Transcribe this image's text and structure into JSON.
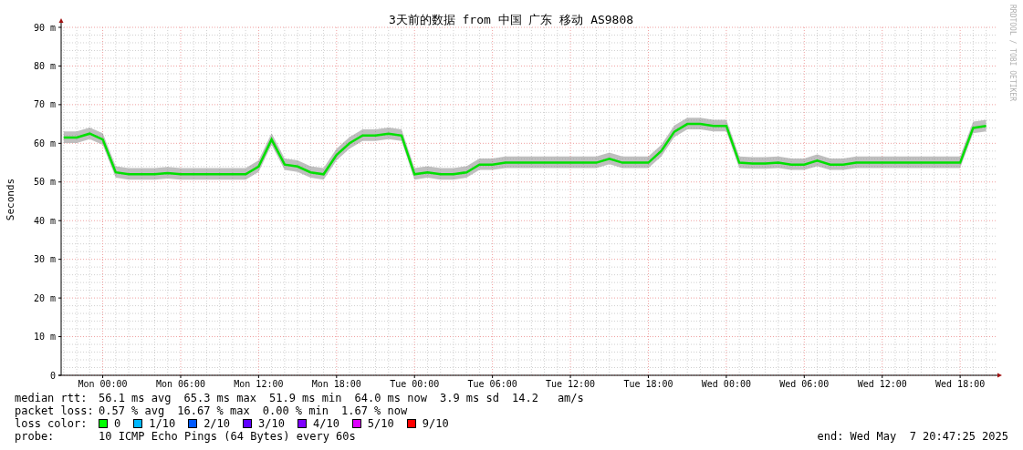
{
  "chart": {
    "chart_data": {
      "type": "line",
      "title": "3天前的数据 from 中国 广东 移动 AS9808",
      "ylabel": "Seconds",
      "categories": [
        null,
        null,
        null,
        "Mon 00:00",
        null,
        null,
        null,
        null,
        null,
        "Mon 06:00",
        null,
        null,
        null,
        null,
        null,
        "Mon 12:00",
        null,
        null,
        null,
        null,
        null,
        "Mon 18:00",
        null,
        null,
        null,
        null,
        null,
        "Tue 00:00",
        null,
        null,
        null,
        null,
        null,
        "Tue 06:00",
        null,
        null,
        null,
        null,
        null,
        "Tue 12:00",
        null,
        null,
        null,
        null,
        null,
        "Tue 18:00",
        null,
        null,
        null,
        null,
        null,
        "Wed 00:00",
        null,
        null,
        null,
        null,
        null,
        "Wed 06:00",
        null,
        null,
        null,
        null,
        null,
        "Wed 12:00",
        null,
        null,
        null,
        null,
        null,
        "Wed 18:00",
        null,
        null
      ],
      "series": [
        {
          "color": "#00e000",
          "values": [
            61.5,
            61.5,
            62.5,
            61,
            52.5,
            52,
            52,
            52,
            52.3,
            52,
            52,
            52,
            52,
            52,
            52,
            54,
            61,
            54.5,
            54,
            52.5,
            52,
            57,
            60,
            62,
            62,
            62.5,
            62,
            52,
            52.5,
            52,
            52,
            52.5,
            54.5,
            54.5,
            55,
            55,
            55,
            55,
            55,
            55,
            55,
            55,
            56,
            55,
            55,
            55,
            58,
            63,
            65,
            65,
            64.5,
            64.5,
            55,
            54.8,
            54.8,
            55,
            54.5,
            54.5,
            55.5,
            54.5,
            54.5,
            55,
            55,
            55,
            55,
            55,
            55,
            55,
            55,
            55,
            64,
            64.5
          ]
        }
      ],
      "ylim": [
        0,
        90
      ],
      "grid": true,
      "yticks": [
        {
          "value": 0,
          "label": "0"
        },
        {
          "value": 10,
          "label": "10 m"
        },
        {
          "value": 20,
          "label": "20 m"
        },
        {
          "value": 30,
          "label": "30 m"
        },
        {
          "value": 40,
          "label": "40 m"
        },
        {
          "value": 50,
          "label": "50 m"
        },
        {
          "value": 60,
          "label": "60 m"
        },
        {
          "value": 70,
          "label": "70 m"
        },
        {
          "value": 80,
          "label": "80 m"
        },
        {
          "value": 90,
          "label": "90 m"
        }
      ]
    },
    "watermark_credit": "RRDTOOL / TOBI OETIKER"
  },
  "legend": {
    "median_rtt": {
      "label": "median rtt:",
      "items": [
        "56.1 ms avg",
        "65.3 ms max",
        "51.9 ms min",
        "64.0 ms now",
        "3.9 ms sd",
        "14.2",
        "am/s"
      ]
    },
    "packet_loss": {
      "label": "packet loss:",
      "items": [
        "0.57 % avg",
        "16.67 % max",
        "0.00 % min",
        "1.67 % now"
      ]
    },
    "loss_color": {
      "label": "loss color:",
      "items": [
        {
          "label": "0",
          "color": "#00ff00"
        },
        {
          "label": "1/10",
          "color": "#00b8ff"
        },
        {
          "label": "2/10",
          "color": "#0059ff"
        },
        {
          "label": "3/10",
          "color": "#5e00ff"
        },
        {
          "label": "4/10",
          "color": "#7e00ff"
        },
        {
          "label": "5/10",
          "color": "#dd00ff"
        },
        {
          "label": "9/10",
          "color": "#ff0000"
        }
      ]
    },
    "probe": {
      "label": "probe:",
      "value": "10 ICMP Echo Pings (64 Bytes) every 60s"
    },
    "end": "end: Wed May  7 20:47:25 2025"
  }
}
